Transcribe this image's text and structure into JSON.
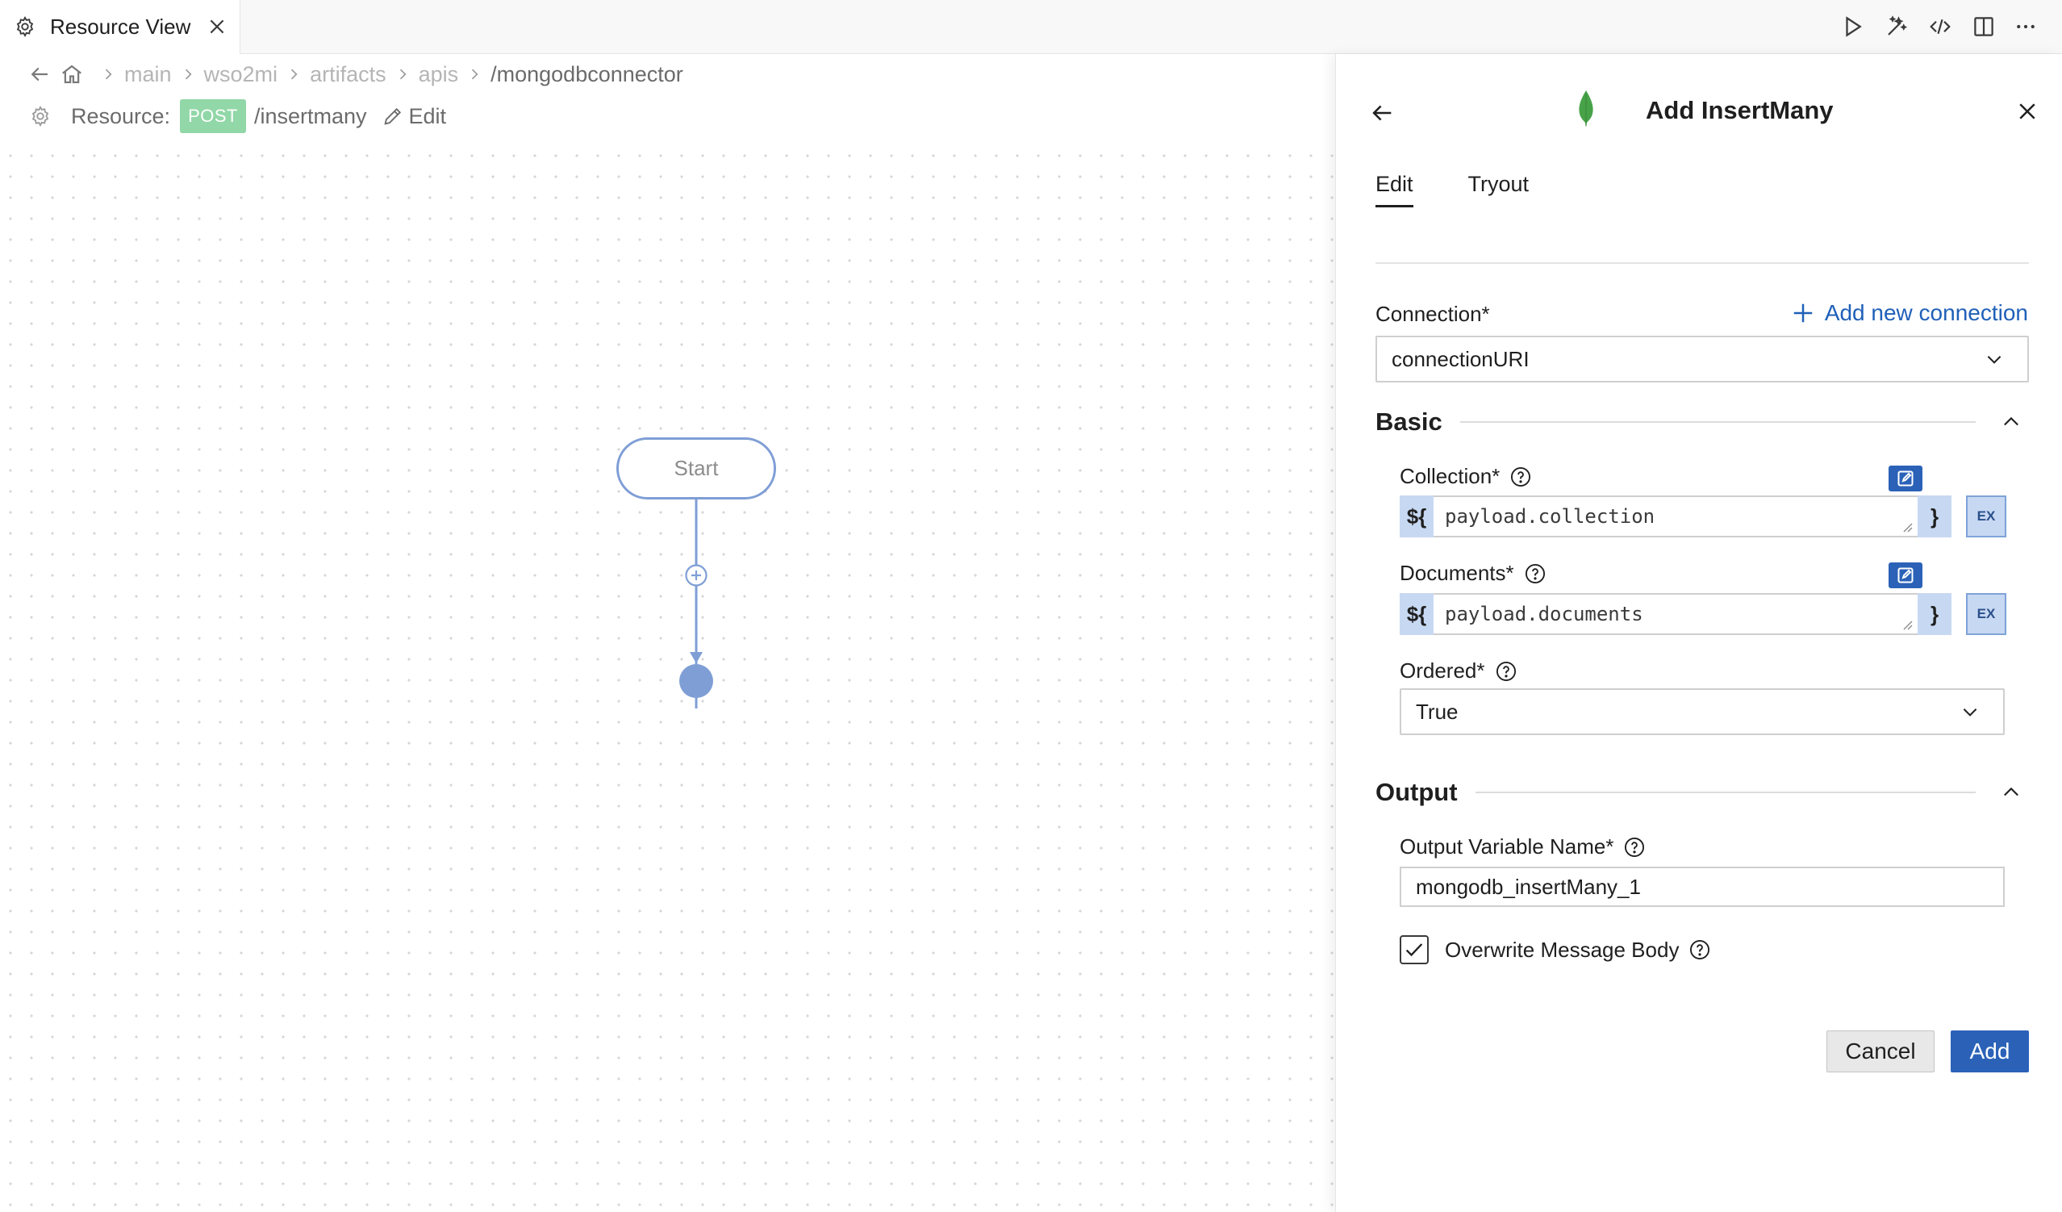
{
  "tab": {
    "title": "Resource View"
  },
  "toolbar": {
    "icons": [
      "run-icon",
      "magic-wand-icon",
      "code-icon",
      "split-editor-icon",
      "more-icon"
    ]
  },
  "breadcrumb": {
    "items": [
      "main",
      "wso2mi",
      "artifacts",
      "apis"
    ],
    "current": "/mongodbconnector"
  },
  "resource": {
    "label": "Resource:",
    "method": "POST",
    "path": "/insertmany",
    "edit_label": "Edit"
  },
  "canvas": {
    "start_label": "Start"
  },
  "panel": {
    "title": "Add InsertMany",
    "tabs": [
      "Edit",
      "Tryout"
    ],
    "active_tab": "Edit",
    "connection": {
      "label": "Connection*",
      "add_new_label": "Add new connection",
      "value": "connectionURI"
    },
    "basic": {
      "title": "Basic",
      "collection": {
        "label": "Collection*",
        "prefix": "${",
        "value": "payload.collection",
        "suffix": "}",
        "ex_label": "EX"
      },
      "documents": {
        "label": "Documents*",
        "prefix": "${",
        "value": "payload.documents",
        "suffix": "}",
        "ex_label": "EX"
      },
      "ordered": {
        "label": "Ordered*",
        "value": "True"
      }
    },
    "output": {
      "title": "Output",
      "variable_label": "Output Variable Name*",
      "variable_value": "mongodb_insertMany_1",
      "overwrite_label": "Overwrite Message Body",
      "overwrite_checked": true
    },
    "buttons": {
      "cancel": "Cancel",
      "add": "Add"
    }
  },
  "colors": {
    "accent": "#2b62b8",
    "link": "#2060b8",
    "post_badge": "#91d7a7",
    "flow_line": "#7f9ed6",
    "expr_bg": "#c7d8f2",
    "mongodb_green": "#47a248"
  }
}
